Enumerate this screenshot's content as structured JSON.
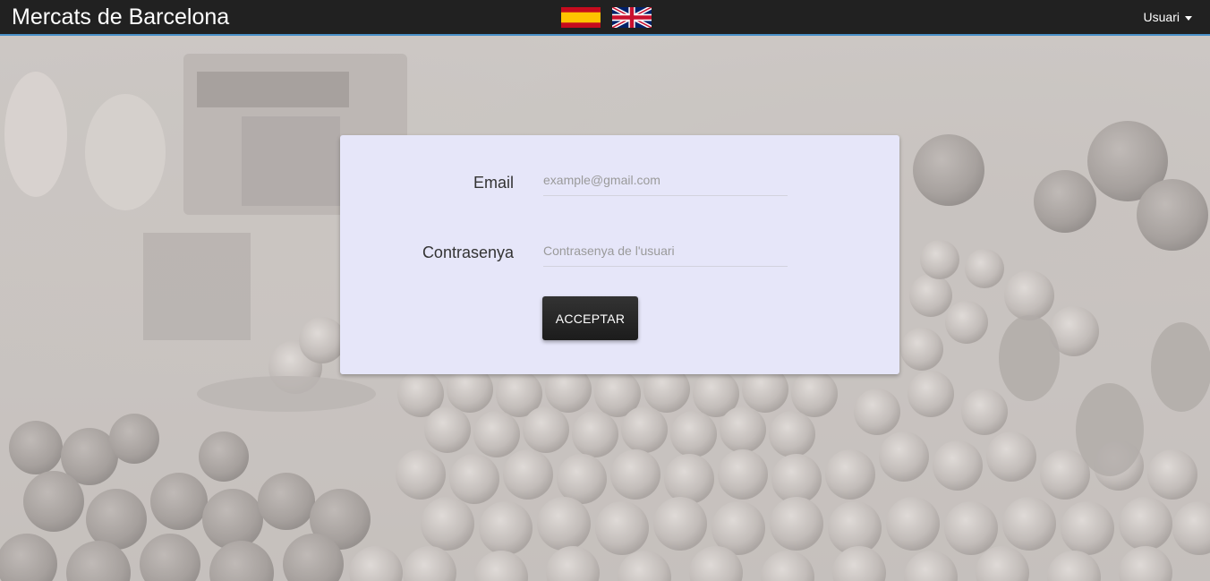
{
  "navbar": {
    "brand": "Mercats de Barcelona",
    "user_menu_label": "Usuari",
    "languages": [
      {
        "code": "es",
        "icon": "spain-flag-icon"
      },
      {
        "code": "en",
        "icon": "uk-flag-icon"
      }
    ],
    "accent_color": "#4a90c8",
    "background_color": "#212121"
  },
  "login": {
    "email_label": "Email",
    "email_placeholder": "example@gmail.com",
    "email_value": "",
    "password_label": "Contrasenya",
    "password_placeholder": "Contrasenya de l'usuari",
    "password_value": "",
    "submit_label": "ACCEPTAR",
    "card_color": "#e6e6f9"
  }
}
